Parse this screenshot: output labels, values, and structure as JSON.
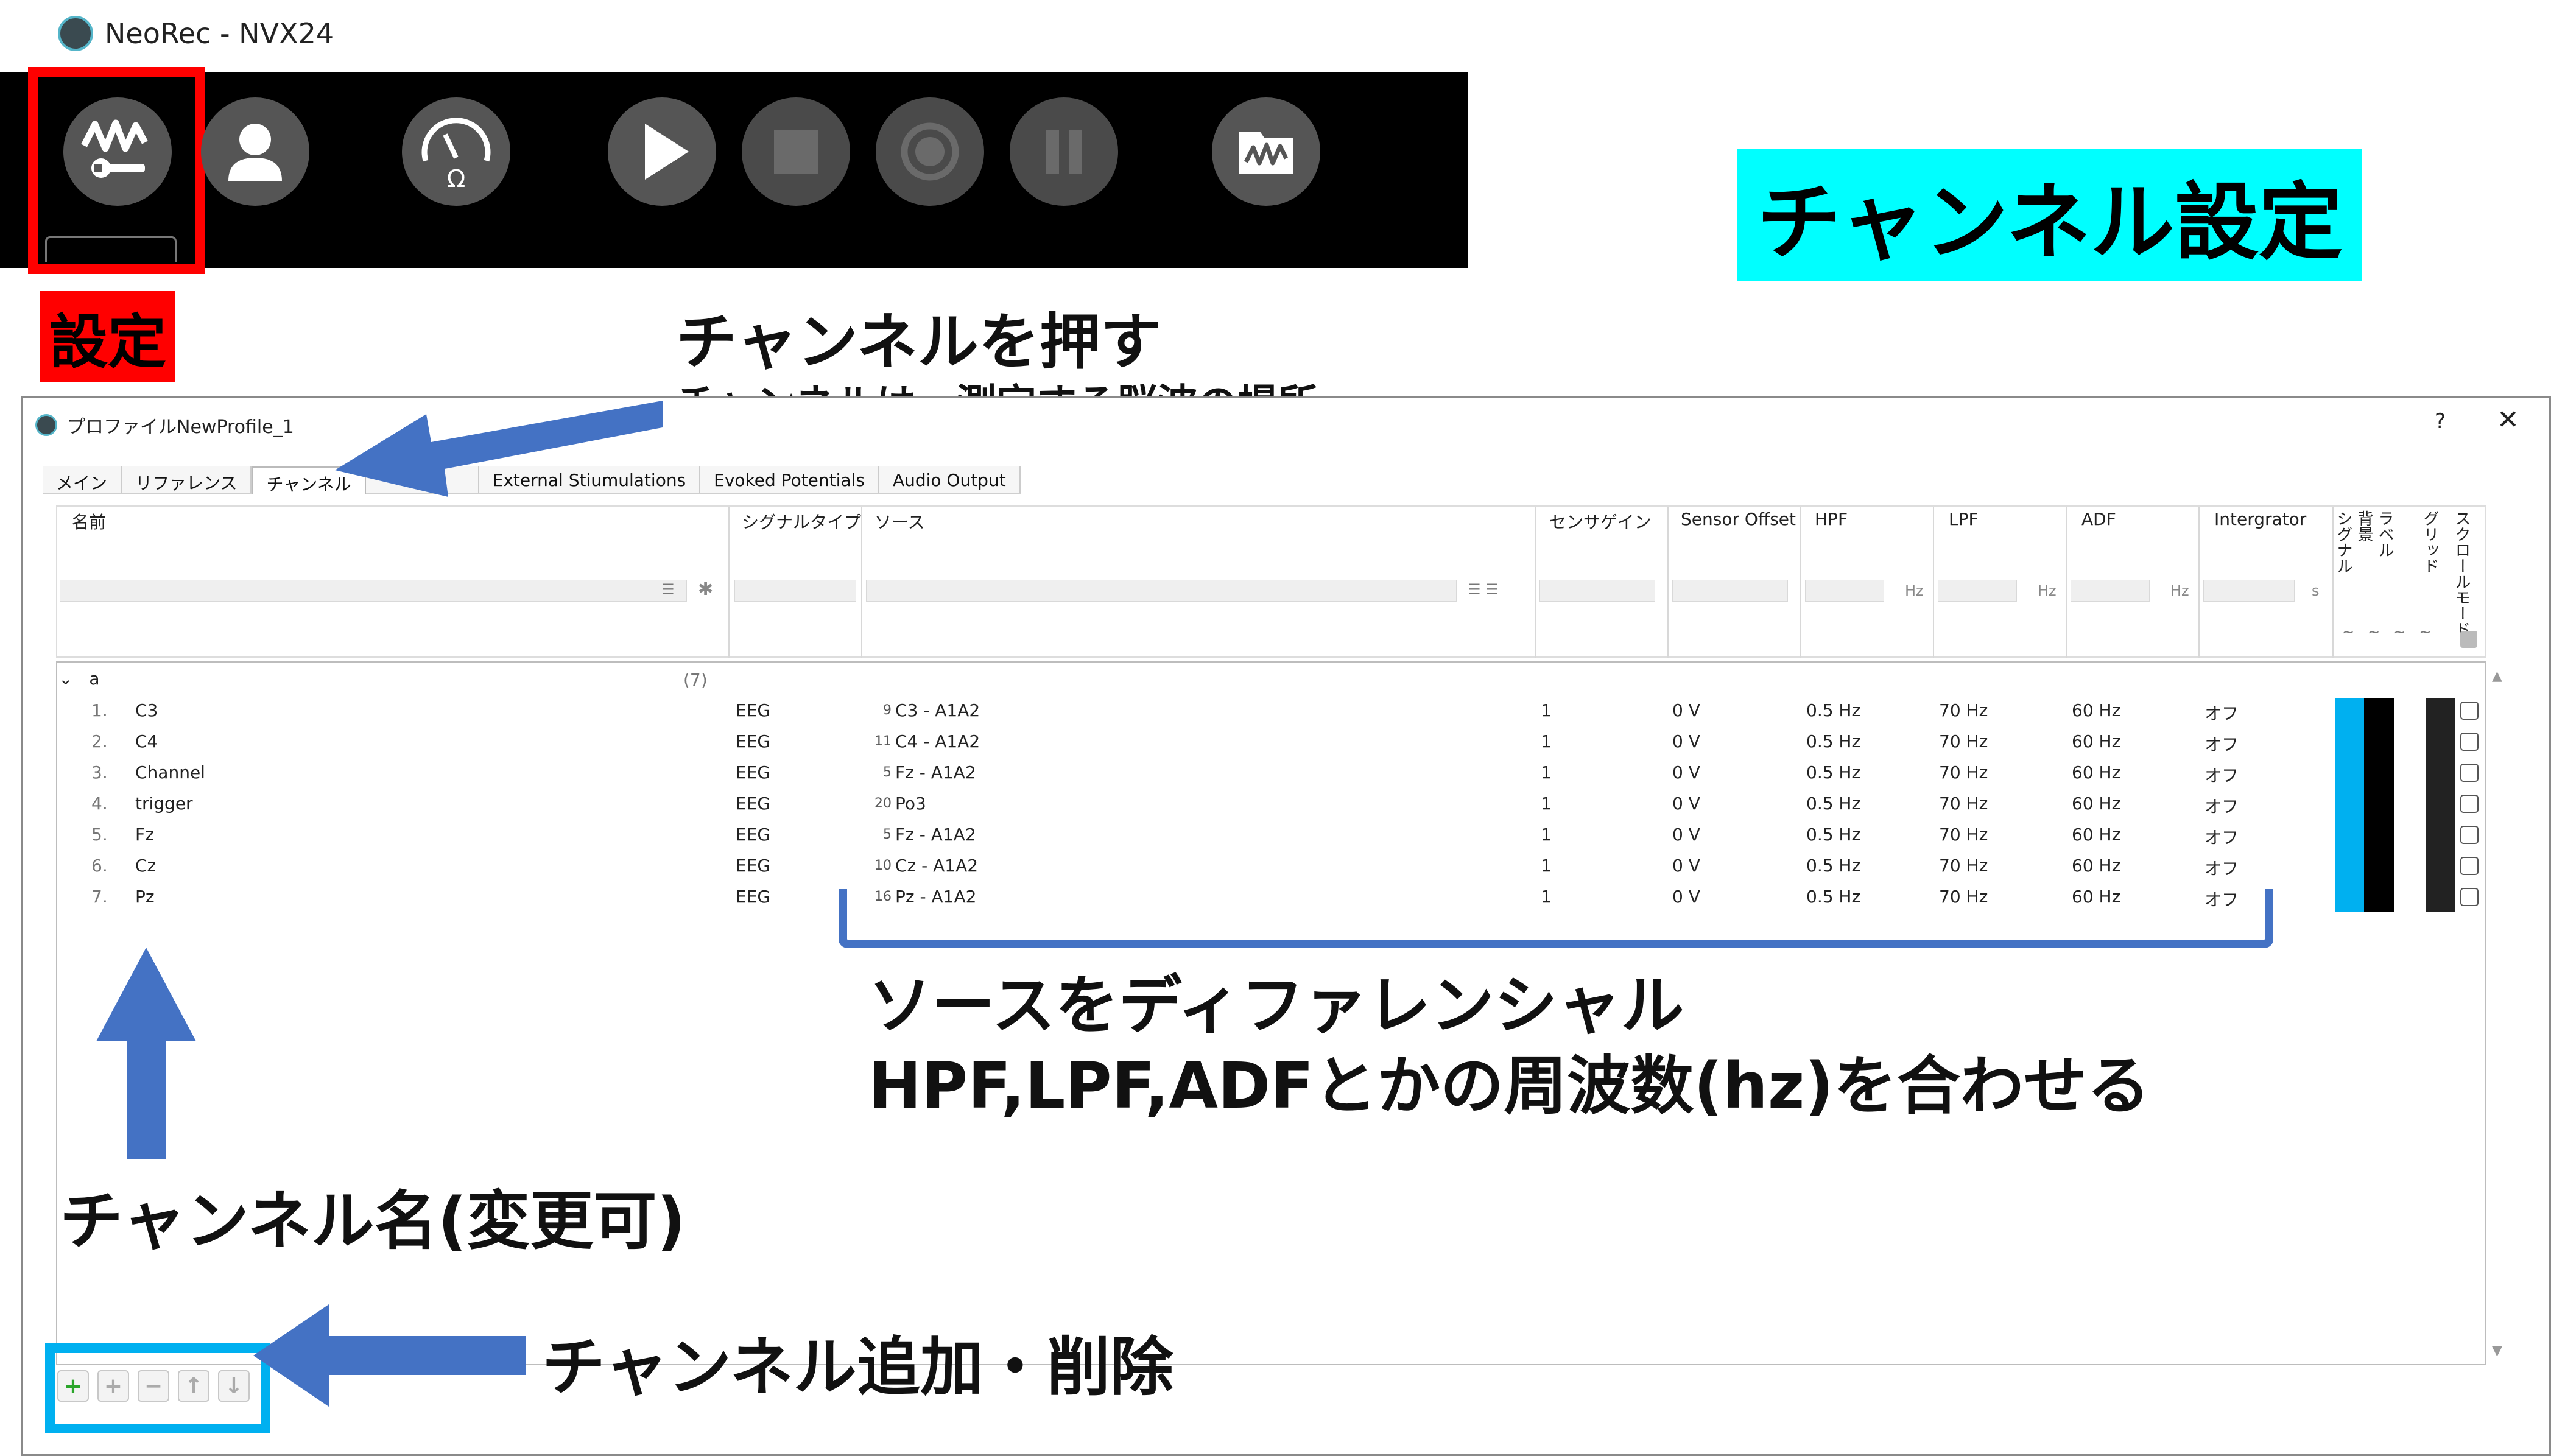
{
  "neorec": {
    "title": "NeoRec - NVX24",
    "toolbar": [
      "settings",
      "profile",
      "impedance",
      "play",
      "stop",
      "record",
      "pause",
      "workspace"
    ]
  },
  "annotations": {
    "settings_label": "設定",
    "title_banner": "チャンネル設定",
    "press_channel": "チャンネルを押す",
    "channel_meaning": "チャンネルは、測定する脳波の場所",
    "source_note_1": "ソースをディファレンシャル",
    "source_note_2": "HPF,LPF,ADFとかの周波数(hz)を合わせる",
    "channel_name": "チャンネル名(変更可)",
    "add_remove": "チャンネル追加・削除"
  },
  "dialog": {
    "title": "プロファイルNewProfile_1",
    "help": "?",
    "close": "✕",
    "tabs": [
      "メイン",
      "リファレンス",
      "チャンネル",
      "",
      "External Stiumulations",
      "Evoked Potentials",
      "Audio Output"
    ],
    "active_tab": 2,
    "columns": {
      "name": "名前",
      "signal_type": "シグナルタイプ",
      "source": "ソース",
      "gain": "センサゲイン",
      "offset": "Sensor Offset",
      "hpf": "HPF",
      "lpf": "LPF",
      "adf": "ADF",
      "integrator": "Intergrator",
      "signal": "シグナル",
      "bg": "背景",
      "label": "ラベル",
      "grid": "グリッド",
      "scroll": "スクロールモード"
    },
    "filter_units": {
      "hz": "Hz",
      "s": "s",
      "tilde": "~"
    },
    "group": {
      "name": "a",
      "count": "(7)"
    },
    "rows": [
      {
        "num": "1.",
        "name": "C3",
        "type": "EEG",
        "src_no": "9",
        "src": "C3 - A1A2",
        "gain": "1",
        "offset": "0 V",
        "hpf": "0.5 Hz",
        "lpf": "70 Hz",
        "adf": "60 Hz",
        "integ": "オフ"
      },
      {
        "num": "2.",
        "name": "C4",
        "type": "EEG",
        "src_no": "11",
        "src": "C4 - A1A2",
        "gain": "1",
        "offset": "0 V",
        "hpf": "0.5 Hz",
        "lpf": "70 Hz",
        "adf": "60 Hz",
        "integ": "オフ"
      },
      {
        "num": "3.",
        "name": "Channel",
        "type": "EEG",
        "src_no": "5",
        "src": "Fz - A1A2",
        "gain": "1",
        "offset": "0 V",
        "hpf": "0.5 Hz",
        "lpf": "70 Hz",
        "adf": "60 Hz",
        "integ": "オフ"
      },
      {
        "num": "4.",
        "name": "trigger",
        "type": "EEG",
        "src_no": "20",
        "src": "Po3",
        "gain": "1",
        "offset": "0 V",
        "hpf": "0.5 Hz",
        "lpf": "70 Hz",
        "adf": "60 Hz",
        "integ": "オフ"
      },
      {
        "num": "5.",
        "name": "Fz",
        "type": "EEG",
        "src_no": "5",
        "src": "Fz - A1A2",
        "gain": "1",
        "offset": "0 V",
        "hpf": "0.5 Hz",
        "lpf": "70 Hz",
        "adf": "60 Hz",
        "integ": "オフ"
      },
      {
        "num": "6.",
        "name": "Cz",
        "type": "EEG",
        "src_no": "10",
        "src": "Cz - A1A2",
        "gain": "1",
        "offset": "0 V",
        "hpf": "0.5 Hz",
        "lpf": "70 Hz",
        "adf": "60 Hz",
        "integ": "オフ"
      },
      {
        "num": "7.",
        "name": "Pz",
        "type": "EEG",
        "src_no": "16",
        "src": "Pz - A1A2",
        "gain": "1",
        "offset": "0 V",
        "hpf": "0.5 Hz",
        "lpf": "70 Hz",
        "adf": "60 Hz",
        "integ": "オフ"
      }
    ],
    "toolbar": [
      "add-green-icon",
      "add-icon",
      "remove-icon",
      "move-up-icon",
      "move-down-icon"
    ]
  },
  "colors": {
    "highlight_red": "#ff0000",
    "banner_cyan": "#00ffff",
    "arrow_blue": "#4472c4",
    "box_blue": "#00b0f0",
    "signal_cyan": "#00b0f0"
  }
}
